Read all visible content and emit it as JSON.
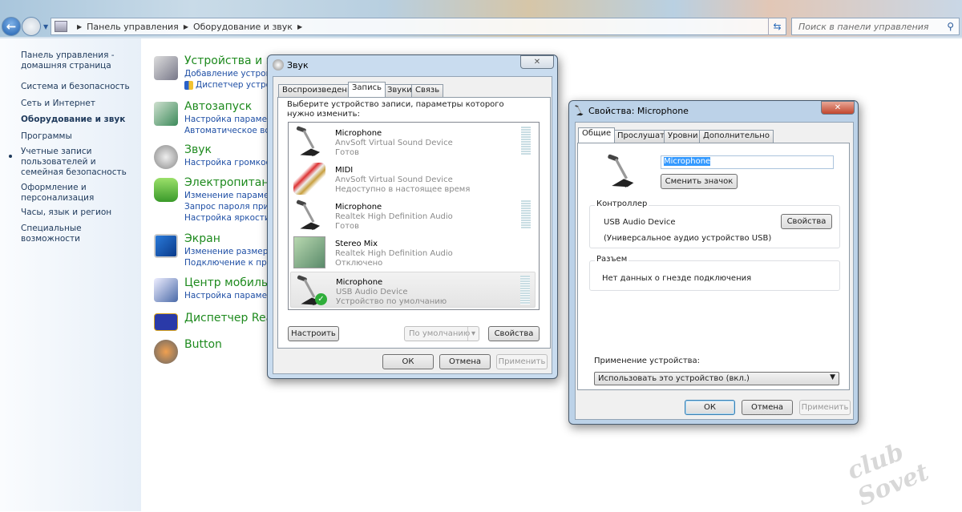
{
  "explorer": {
    "breadcrumb": [
      "Панель управления",
      "Оборудование и звук"
    ],
    "search_placeholder": "Поиск в панели управления"
  },
  "sidebar": {
    "items": [
      {
        "label": "Панель управления - домашняя страница"
      },
      {
        "label": "Система и безопасность"
      },
      {
        "label": "Сеть и Интернет"
      },
      {
        "label": "Оборудование и звук",
        "active": true
      },
      {
        "label": "Программы"
      },
      {
        "label": "Учетные записи пользователей и семейная безопасность"
      },
      {
        "label": "Оформление и персонализация"
      },
      {
        "label": "Часы, язык и регион"
      },
      {
        "label": "Специальные возможности"
      }
    ]
  },
  "categories": [
    {
      "title": "Устройства и пр",
      "links": [
        "Добавление устройст",
        "Диспетчер устрой"
      ]
    },
    {
      "title": "Автозапуск",
      "links": [
        "Настройка параметр",
        "Автоматическое восп"
      ]
    },
    {
      "title": "Звук",
      "links": [
        "Настройка громкост"
      ]
    },
    {
      "title": "Электропитание",
      "links": [
        "Изменение параметр",
        "Запрос пароля при в",
        "Настройка яркости э"
      ]
    },
    {
      "title": "Экран",
      "links": [
        "Изменение размеров",
        "Подключение к прое"
      ]
    },
    {
      "title": "Центр мобильно",
      "links": [
        "Настройка параметр"
      ]
    },
    {
      "title": "Диспетчер Realt",
      "links": []
    },
    {
      "title": "Button",
      "links": []
    }
  ],
  "sound_dialog": {
    "title": "Звук",
    "close": "✕",
    "tabs": [
      "Воспроизведение",
      "Запись",
      "Звуки",
      "Связь"
    ],
    "active_tab": "Запись",
    "instruction": "Выберите устройство записи, параметры которого нужно изменить:",
    "devices": [
      {
        "name": "Microphone",
        "driver": "AnvSoft Virtual Sound Device",
        "status": "Готов",
        "icon": "microphone-icon"
      },
      {
        "name": "MIDI",
        "driver": "AnvSoft Virtual Sound Device",
        "status": "Недоступно в настоящее время",
        "icon": "midi-cable-icon"
      },
      {
        "name": "Microphone",
        "driver": "Realtek High Definition Audio",
        "status": "Готов",
        "icon": "microphone-icon"
      },
      {
        "name": "Stereo Mix",
        "driver": "Realtek High Definition Audio",
        "status": "Отключено",
        "icon": "sound-card-icon"
      },
      {
        "name": "Microphone",
        "driver": "USB Audio Device",
        "status": "Устройство по умолчанию",
        "icon": "microphone-icon",
        "selected": true
      }
    ],
    "configure": "Настроить",
    "set_default": "По умолчанию",
    "properties": "Свойства",
    "ok": "ОК",
    "cancel": "Отмена",
    "apply": "Применить"
  },
  "props_dialog": {
    "title": "Свойства: Microphone",
    "close": "✕",
    "tabs": [
      "Общие",
      "Прослушать",
      "Уровни",
      "Дополнительно"
    ],
    "active_tab": "Общие",
    "name_value": "Microphone",
    "change_icon": "Сменить значок",
    "controller_label": "Контроллер",
    "controller_name": "USB Audio Device",
    "controller_properties": "Свойства",
    "controller_desc": "(Универсальное аудио устройство USB)",
    "jack_label": "Разъем",
    "jack_info": "Нет данных о гнезде подключения",
    "usage_label": "Применение устройства:",
    "usage_value": "Использовать это устройство (вкл.)",
    "ok": "ОК",
    "cancel": "Отмена",
    "apply": "Применить"
  },
  "watermark": "club Sovet"
}
